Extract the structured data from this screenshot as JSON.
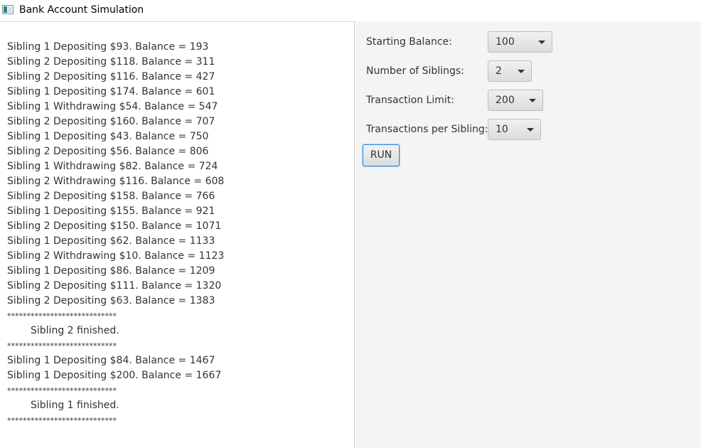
{
  "window": {
    "title": "Bank Account Simulation"
  },
  "log": {
    "lines": [
      {
        "text": "Sibling 1 Depositing $93. Balance = 193",
        "kind": "entry"
      },
      {
        "text": "Sibling 2 Depositing $118. Balance = 311",
        "kind": "entry"
      },
      {
        "text": "Sibling 2 Depositing $116. Balance = 427",
        "kind": "entry"
      },
      {
        "text": "Sibling 1 Depositing $174. Balance = 601",
        "kind": "entry"
      },
      {
        "text": "Sibling 1 Withdrawing $54. Balance = 547",
        "kind": "entry"
      },
      {
        "text": "Sibling 2 Depositing $160. Balance = 707",
        "kind": "entry"
      },
      {
        "text": "Sibling 1 Depositing $43. Balance = 750",
        "kind": "entry"
      },
      {
        "text": "Sibling 2 Depositing $56. Balance = 806",
        "kind": "entry"
      },
      {
        "text": "Sibling 1 Withdrawing $82. Balance = 724",
        "kind": "entry"
      },
      {
        "text": "Sibling 2 Withdrawing $116. Balance = 608",
        "kind": "entry"
      },
      {
        "text": "Sibling 2 Depositing $158. Balance = 766",
        "kind": "entry"
      },
      {
        "text": "Sibling 1 Depositing $155. Balance = 921",
        "kind": "entry"
      },
      {
        "text": "Sibling 2 Depositing $150. Balance = 1071",
        "kind": "entry"
      },
      {
        "text": "Sibling 1 Depositing $62. Balance = 1133",
        "kind": "entry"
      },
      {
        "text": "Sibling 2 Withdrawing $10. Balance = 1123",
        "kind": "entry"
      },
      {
        "text": "Sibling 1 Depositing $86. Balance = 1209",
        "kind": "entry"
      },
      {
        "text": "Sibling 2 Depositing $111. Balance = 1320",
        "kind": "entry"
      },
      {
        "text": "Sibling 2 Depositing $63. Balance = 1383",
        "kind": "entry"
      },
      {
        "text": "****************************",
        "kind": "separator"
      },
      {
        "text": "Sibling 2 finished.",
        "kind": "status"
      },
      {
        "text": "****************************",
        "kind": "separator"
      },
      {
        "text": "Sibling 1 Depositing $84. Balance = 1467",
        "kind": "entry"
      },
      {
        "text": "Sibling 1 Depositing $200. Balance = 1667",
        "kind": "entry"
      },
      {
        "text": "****************************",
        "kind": "separator"
      },
      {
        "text": "Sibling 1 finished.",
        "kind": "status"
      },
      {
        "text": "****************************",
        "kind": "separator"
      }
    ]
  },
  "controls": {
    "starting_balance": {
      "label": "Starting Balance:",
      "value": "100"
    },
    "number_of_siblings": {
      "label": "Number of Siblings:",
      "value": "2"
    },
    "transaction_limit": {
      "label": "Transaction Limit:",
      "value": "200"
    },
    "transactions_per_sibling": {
      "label": "Transactions per Sibling:",
      "value": "10"
    },
    "run_label": "RUN"
  }
}
